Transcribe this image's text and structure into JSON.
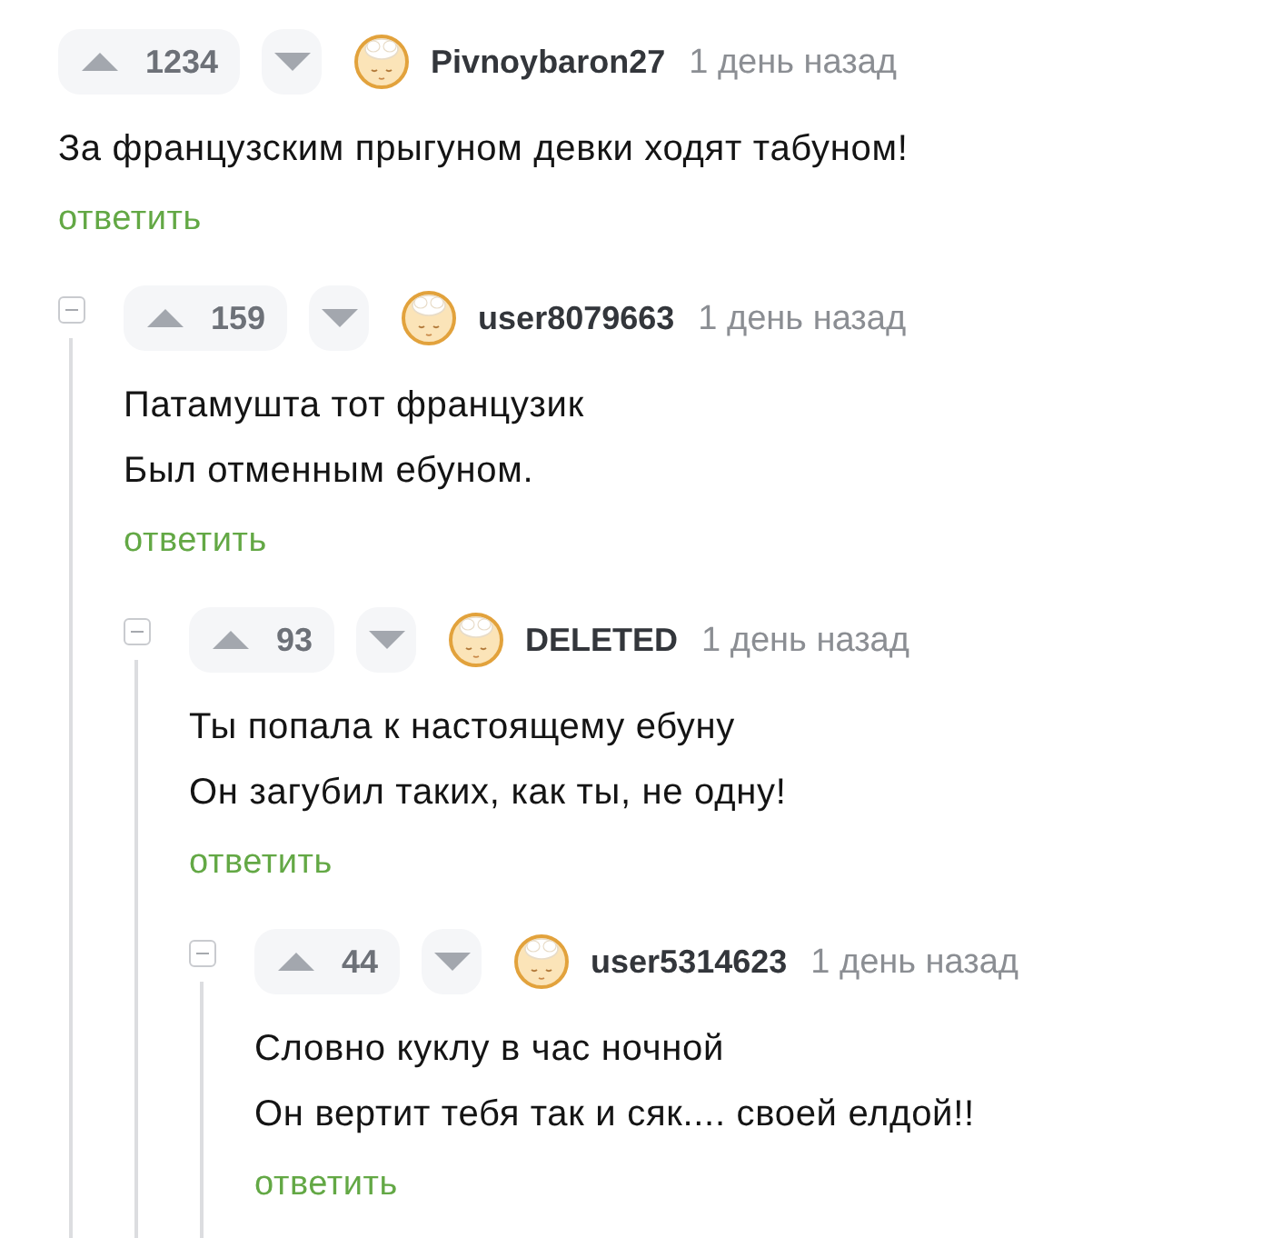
{
  "comment": {
    "votes": "1234",
    "username": "Pivnoybaron27",
    "time": "1 день назад",
    "lines": [
      "За французским прыгуном девки ходят табуном!"
    ],
    "reply": "ответить",
    "replies": [
      {
        "expanded": true,
        "votes": "159",
        "username": "user8079663",
        "time": "1 день назад",
        "lines": [
          "Патамушта тот французик",
          "Был отменным ебуном."
        ],
        "reply": "ответить",
        "replies": [
          {
            "expanded": true,
            "votes": "93",
            "username": "DELETED",
            "time": "1 день назад",
            "lines": [
              "Ты попала к настоящему ебуну",
              "Он загубил таких, как ты, не одну!"
            ],
            "reply": "ответить",
            "replies": [
              {
                "expanded": true,
                "votes": "44",
                "username": "user5314623",
                "time": "1 день назад",
                "lines": [
                  "Словно куклу в час ночной",
                  "Он вертит тебя так и сяк.... своей елдой!!"
                ],
                "reply": "ответить"
              }
            ]
          }
        ]
      }
    ]
  }
}
